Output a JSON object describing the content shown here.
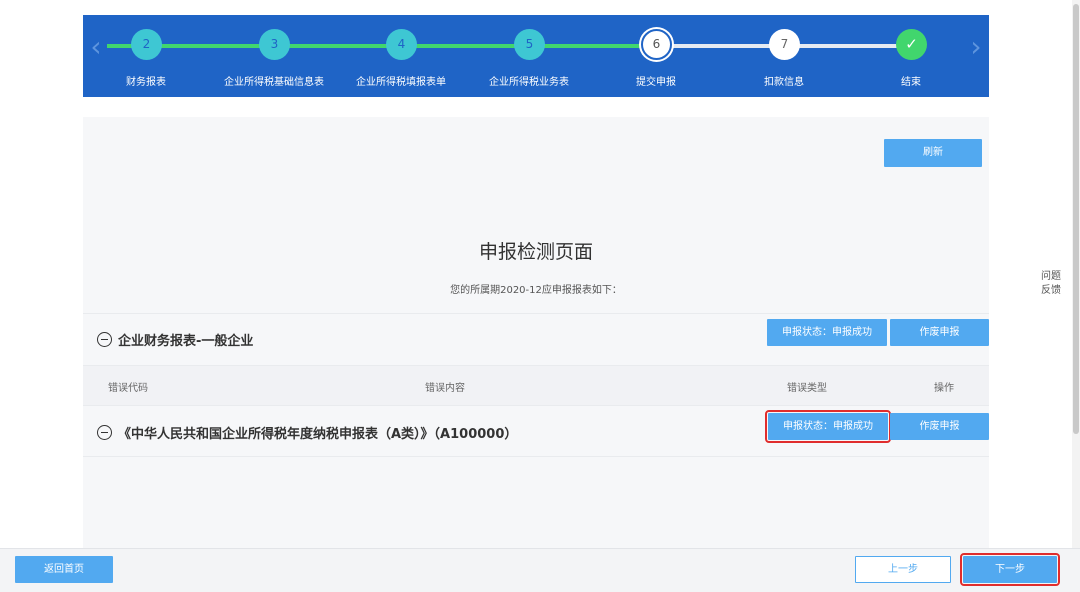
{
  "steps": [
    {
      "num": "2",
      "label": "财务报表",
      "state": "done"
    },
    {
      "num": "3",
      "label": "企业所得税基础信息表",
      "state": "done"
    },
    {
      "num": "4",
      "label": "企业所得税填报表单",
      "state": "done"
    },
    {
      "num": "5",
      "label": "企业所得税业务表",
      "state": "done"
    },
    {
      "num": "6",
      "label": "提交申报",
      "state": "current"
    },
    {
      "num": "7",
      "label": "扣款信息",
      "state": "todo"
    },
    {
      "num": "✓",
      "label": "结束",
      "state": "finish"
    }
  ],
  "nav": {
    "prev_arrow": "‹",
    "next_arrow": "›"
  },
  "toolbar": {
    "refresh_label": "刷新"
  },
  "page": {
    "title": "申报检测页面",
    "subtitle": "您的所属期2020-12应申报报表如下："
  },
  "section": {
    "title": "企业财务报表-一般企业",
    "status_label": "申报状态：申报成功",
    "void_label": "作废申报"
  },
  "table": {
    "headers": [
      "错误代码",
      "错误内容",
      "错误类型",
      "操作"
    ]
  },
  "row": {
    "title": "《中华人民共和国企业所得税年度纳税申报表（A类）》（A100000）",
    "status_label": "申报状态：申报成功",
    "void_label": "作废申报"
  },
  "footer": {
    "home_label": "返回首页",
    "prev_label": "上一步",
    "next_label": "下一步"
  },
  "feedback": {
    "line1": "问题",
    "line2": "反馈"
  },
  "colors": {
    "header_bg": "#1f64c6",
    "progress_done": "#41d66d",
    "button_blue": "#52a9f0",
    "highlight_red": "#e02d2d"
  }
}
